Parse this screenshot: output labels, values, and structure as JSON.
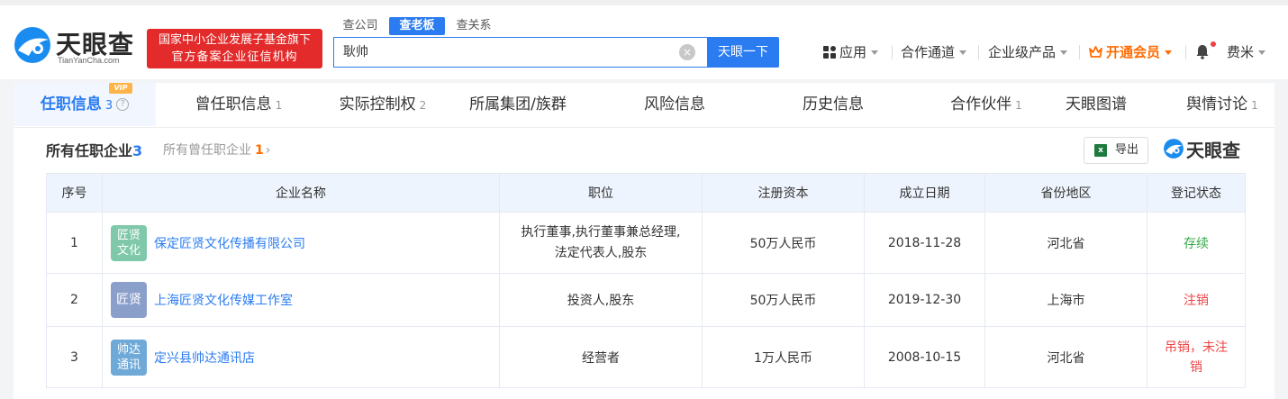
{
  "header": {
    "logo": {
      "name": "天眼查",
      "sub": "TianYanCha.com"
    },
    "badge": {
      "line1": "国家中小企业发展子基金旗下",
      "line2": "官方备案企业征信机构"
    },
    "search_tabs": [
      "查公司",
      "查老板",
      "查关系"
    ],
    "search_value": "耿帅",
    "search_button": "天眼一下",
    "nav": {
      "apps": "应用",
      "cooperation": "合作通道",
      "enterprise": "企业级产品",
      "vip": "开通会员",
      "user": "费米"
    }
  },
  "tabs": [
    {
      "label": "任职信息",
      "count": "3",
      "vip": "VIP"
    },
    {
      "label": "曾任职信息",
      "count": "1"
    },
    {
      "label": "实际控制权",
      "count": "2"
    },
    {
      "label": "所属集团/族群",
      "count": ""
    },
    {
      "label": "风险信息",
      "count": ""
    },
    {
      "label": "历史信息",
      "count": ""
    },
    {
      "label": "合作伙伴",
      "count": "1"
    },
    {
      "label": "天眼图谱",
      "count": ""
    },
    {
      "label": "舆情讨论",
      "count": "1"
    }
  ],
  "section": {
    "title": "所有任职企业",
    "count": "3",
    "sub_label": "所有曾任职企业",
    "sub_count": "1",
    "export": "导出",
    "watermark": "天眼查"
  },
  "table": {
    "headers": [
      "序号",
      "企业名称",
      "职位",
      "注册资本",
      "成立日期",
      "省份地区",
      "登记状态"
    ],
    "rows": [
      {
        "no": "1",
        "logo_line1": "匠贤",
        "logo_line2": "文化",
        "logo_color": "#7fc8a9",
        "name": "保定匠贤文化传播有限公司",
        "position_l1": "执行董事,执行董事兼总经理,",
        "position_l2": "法定代表人,股东",
        "capital": "50万人民币",
        "date": "2018-11-28",
        "region": "河北省",
        "status_l1": "存续",
        "status_l2": "",
        "status_type": "ok"
      },
      {
        "no": "2",
        "logo_line1": "匠贤",
        "logo_line2": "",
        "logo_color": "#8b9fcb",
        "name": "上海匠贤文化传媒工作室",
        "position_l1": "投资人,股东",
        "position_l2": "",
        "capital": "50万人民币",
        "date": "2019-12-30",
        "region": "上海市",
        "status_l1": "注销",
        "status_l2": "",
        "status_type": "bad"
      },
      {
        "no": "3",
        "logo_line1": "帅达",
        "logo_line2": "通讯",
        "logo_color": "#6fa9d8",
        "name": "定兴县帅达通讯店",
        "position_l1": "经营者",
        "position_l2": "",
        "capital": "1万人民币",
        "date": "2008-10-15",
        "region": "河北省",
        "status_l1": "吊销，未注",
        "status_l2": "销",
        "status_type": "bad"
      }
    ]
  }
}
